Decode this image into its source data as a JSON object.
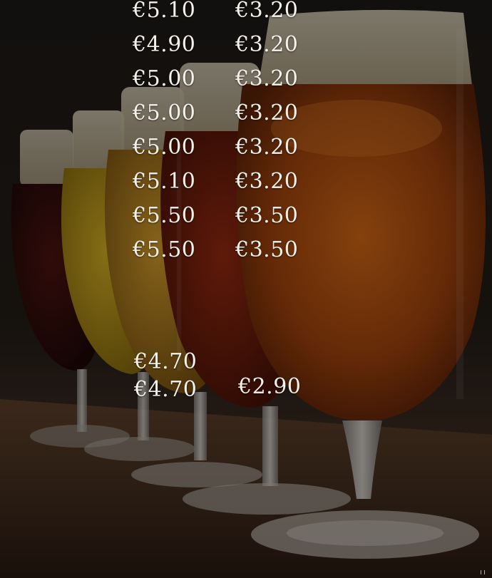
{
  "upper_prices": {
    "column_a": [
      "€5.10",
      "€4.90",
      "€5.00",
      "€5.00",
      "€5.00",
      "€5.10",
      "€5.50",
      "€5.50"
    ],
    "column_b": [
      "€3.20",
      "€3.20",
      "€3.20",
      "€3.20",
      "€3.20",
      "€3.20",
      "€3.50",
      "€3.50"
    ]
  },
  "lower_prices": {
    "column_a": [
      "€4.70",
      "€4.70"
    ],
    "column_b": [
      "€2.90"
    ]
  },
  "colors": {
    "text": "#f4f0ea",
    "background": "#141111"
  },
  "icons": [
    "corner-mark-icon"
  ]
}
